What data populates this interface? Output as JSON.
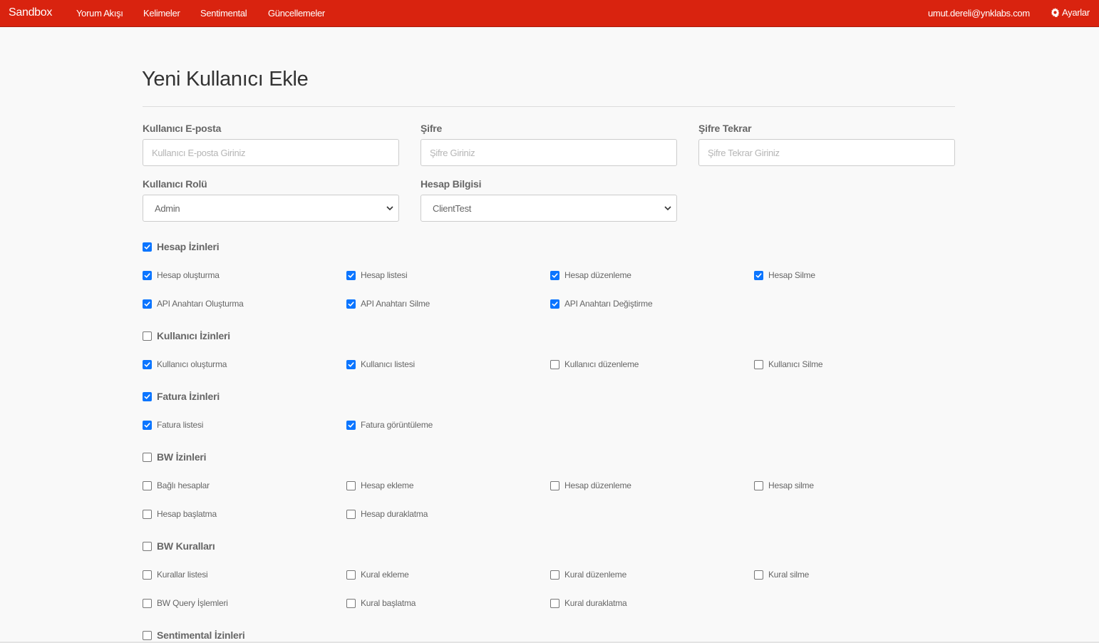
{
  "navbar": {
    "brand": "Sandbox",
    "links": [
      "Yorum Akışı",
      "Kelimeler",
      "Sentimental",
      "Güncellemeler"
    ],
    "user_email": "umut.dereli@ynklabs.com",
    "settings_label": "Ayarlar"
  },
  "page": {
    "title": "Yeni Kullanıcı Ekle"
  },
  "form": {
    "email": {
      "label": "Kullanıcı E-posta",
      "placeholder": "Kullanıcı E-posta Giriniz",
      "value": ""
    },
    "password": {
      "label": "Şifre",
      "placeholder": "Şifre Giriniz",
      "value": ""
    },
    "password_repeat": {
      "label": "Şifre Tekrar",
      "placeholder": "Şifre Tekrar Giriniz",
      "value": ""
    },
    "role": {
      "label": "Kullanıcı Rolü",
      "selected": "Admin"
    },
    "account": {
      "label": "Hesap Bilgisi",
      "selected": "ClientTest"
    }
  },
  "permission_groups": [
    {
      "label": "Hesap İzinleri",
      "checked": true,
      "items": [
        {
          "label": "Hesap oluşturma",
          "checked": true
        },
        {
          "label": "Hesap listesi",
          "checked": true
        },
        {
          "label": "Hesap düzenleme",
          "checked": true
        },
        {
          "label": "Hesap Silme",
          "checked": true
        },
        {
          "label": "API Anahtarı Oluşturma",
          "checked": true
        },
        {
          "label": "API Anahtarı Silme",
          "checked": true
        },
        {
          "label": "API Anahtarı Değiştirme",
          "checked": true
        }
      ]
    },
    {
      "label": "Kullanıcı İzinleri",
      "checked": false,
      "items": [
        {
          "label": "Kullanıcı oluşturma",
          "checked": true
        },
        {
          "label": "Kullanıcı listesi",
          "checked": true
        },
        {
          "label": "Kullanıcı düzenleme",
          "checked": false
        },
        {
          "label": "Kullanıcı Silme",
          "checked": false
        }
      ]
    },
    {
      "label": "Fatura İzinleri",
      "checked": true,
      "items": [
        {
          "label": "Fatura listesi",
          "checked": true
        },
        {
          "label": "Fatura görüntüleme",
          "checked": true
        }
      ]
    },
    {
      "label": "BW İzinleri",
      "checked": false,
      "items": [
        {
          "label": "Bağlı hesaplar",
          "checked": false
        },
        {
          "label": "Hesap ekleme",
          "checked": false
        },
        {
          "label": "Hesap düzenleme",
          "checked": false
        },
        {
          "label": "Hesap silme",
          "checked": false
        },
        {
          "label": "Hesap başlatma",
          "checked": false
        },
        {
          "label": "Hesap duraklatma",
          "checked": false
        }
      ]
    },
    {
      "label": "BW Kuralları",
      "checked": false,
      "items": [
        {
          "label": "Kurallar listesi",
          "checked": false
        },
        {
          "label": "Kural ekleme",
          "checked": false
        },
        {
          "label": "Kural düzenleme",
          "checked": false
        },
        {
          "label": "Kural silme",
          "checked": false
        },
        {
          "label": "BW Query İşlemleri",
          "checked": false
        },
        {
          "label": "Kural başlatma",
          "checked": false
        },
        {
          "label": "Kural duraklatma",
          "checked": false
        }
      ]
    },
    {
      "label": "Sentimental İzinleri",
      "checked": false,
      "items": []
    }
  ],
  "colors": {
    "navbar": "#d9230f",
    "checkbox_checked": "#0b75ff",
    "background": "#f9f9f9"
  }
}
